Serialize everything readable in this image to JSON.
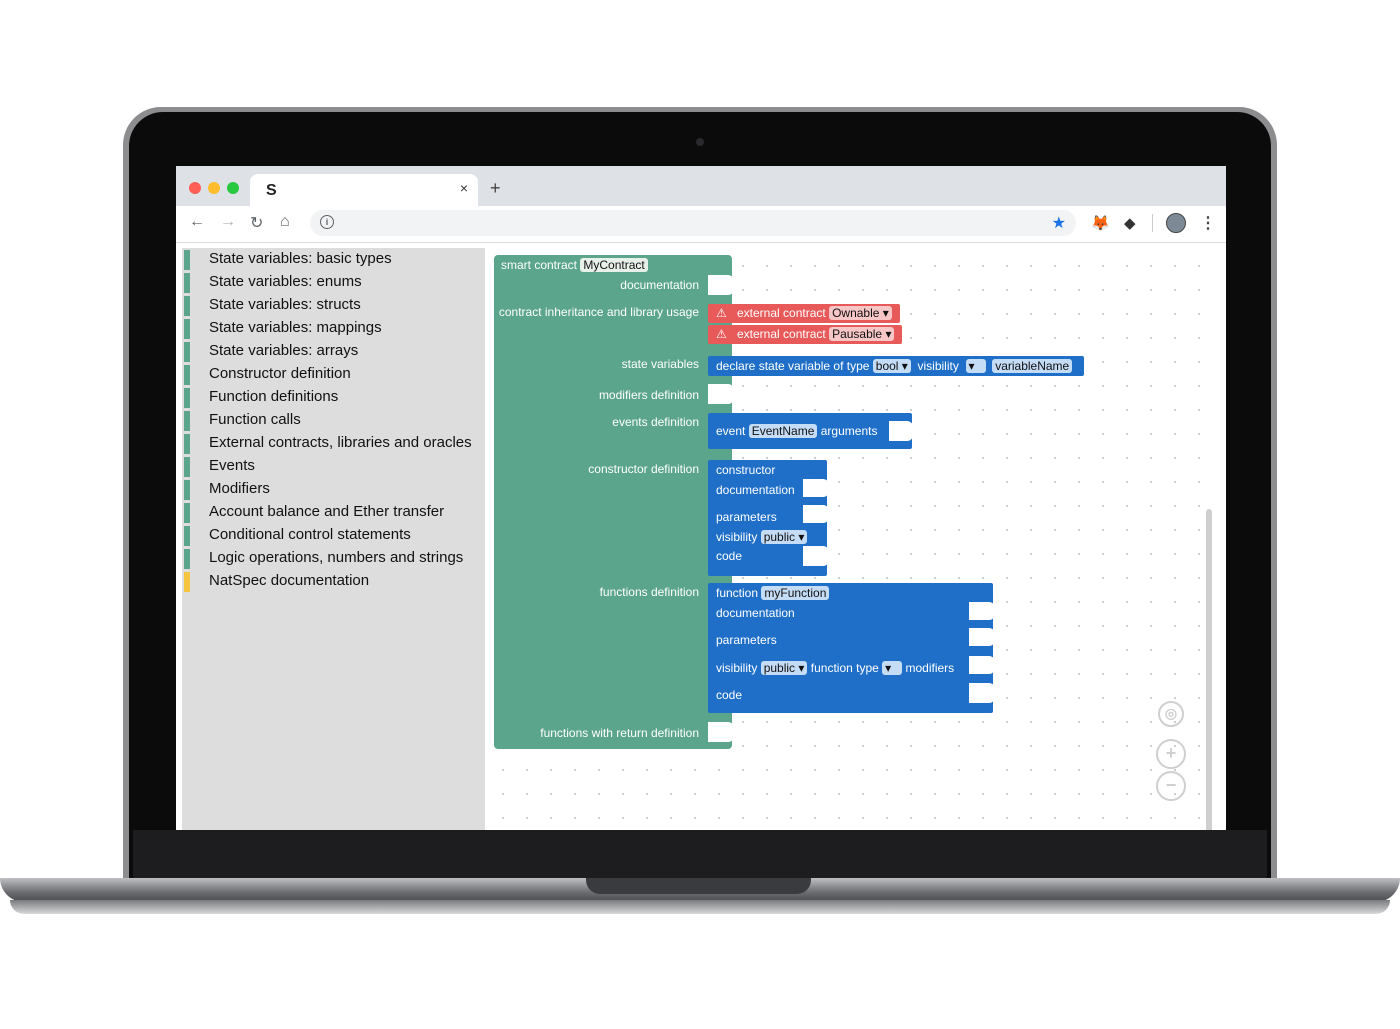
{
  "browser": {
    "tab_icon": "S",
    "tab_close": "×",
    "new_tab": "+",
    "nav_back": "←",
    "nav_forward": "→",
    "nav_reload": "↻",
    "nav_home": "⌂",
    "info_icon": "i",
    "menu_dots": "⋮"
  },
  "sidebar": {
    "items": [
      {
        "label": "State variables: basic types",
        "color": "#5ba58c"
      },
      {
        "label": "State variables: enums",
        "color": "#5ba58c"
      },
      {
        "label": "State variables: structs",
        "color": "#5ba58c"
      },
      {
        "label": "State variables: mappings",
        "color": "#5ba58c"
      },
      {
        "label": "State variables: arrays",
        "color": "#5ba58c"
      },
      {
        "label": "Constructor definition",
        "color": "#5ba58c"
      },
      {
        "label": "Function definitions",
        "color": "#5ba58c"
      },
      {
        "label": "Function calls",
        "color": "#5ba58c"
      },
      {
        "label": "External contracts, libraries and oracles",
        "color": "#5ba58c"
      },
      {
        "label": "Events",
        "color": "#5ba58c"
      },
      {
        "label": "Modifiers",
        "color": "#5ba58c"
      },
      {
        "label": "Account balance and Ether transfer",
        "color": "#5ba58c"
      },
      {
        "label": "Conditional control statements",
        "color": "#5ba58c"
      },
      {
        "label": "Logic operations, numbers and strings",
        "color": "#5ba58c"
      },
      {
        "label": "NatSpec documentation",
        "color": "#f5c542"
      }
    ]
  },
  "contract": {
    "header": "smart contract",
    "name": "MyContract",
    "documentation": "documentation",
    "inheritance": "contract inheritance and library usage",
    "state_variables": "state variables",
    "modifiers_definition": "modifiers definition",
    "events_definition": "events definition",
    "constructor_definition": "constructor definition",
    "functions_definition": "functions definition",
    "functions_with_return": "functions with return definition"
  },
  "externals": [
    {
      "label": "external contract",
      "value": "Ownable"
    },
    {
      "label": "external contract",
      "value": "Pausable"
    }
  ],
  "state_var": {
    "label": "declare state variable of type",
    "type": "bool",
    "visibility_label": "visibility",
    "visibility_value": "",
    "name": "variableName"
  },
  "event": {
    "label": "event",
    "name": "EventName",
    "arguments": "arguments"
  },
  "constructor": {
    "label": "constructor",
    "documentation": "documentation",
    "parameters": "parameters",
    "visibility_label": "visibility",
    "visibility_value": "public",
    "code": "code"
  },
  "function": {
    "label": "function",
    "name": "myFunction",
    "documentation": "documentation",
    "parameters": "parameters",
    "visibility_label": "visibility",
    "visibility_value": "public",
    "function_type_label": "function type",
    "modifiers_label": "modifiers",
    "code": "code"
  },
  "dropdown_arrow": "▾",
  "colors": {
    "contract_block": "#5ba58c",
    "external_block": "#e85a5a",
    "blue_block": "#1f6fc8",
    "natspec_category": "#f5c542"
  }
}
